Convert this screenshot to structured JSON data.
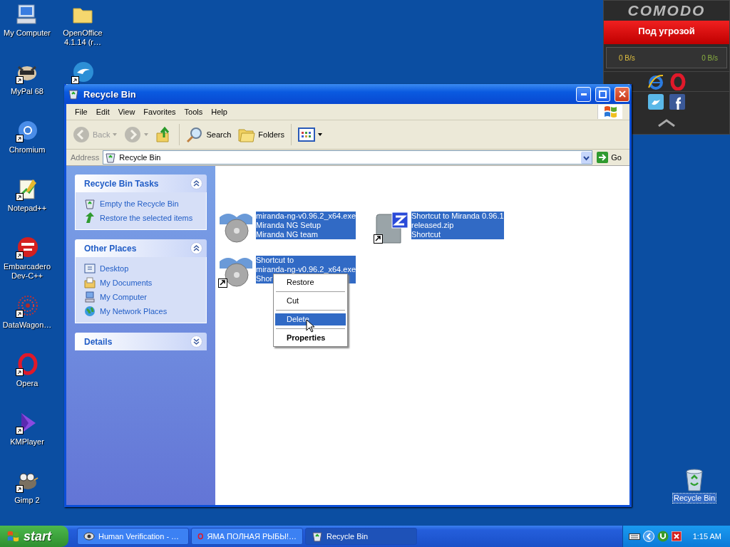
{
  "desktop": {
    "columns": [
      [
        {
          "label": "My Computer",
          "kind": "computer",
          "shortcut": false
        },
        {
          "label": "MyPal 68",
          "kind": "raccoon",
          "shortcut": true
        },
        {
          "label": "Chromium",
          "kind": "chromium",
          "shortcut": true
        },
        {
          "label": "Notepad++",
          "kind": "notepad",
          "shortcut": true
        },
        {
          "label": "Embarcadero Dev-C++",
          "kind": "dev",
          "shortcut": true
        },
        {
          "label": "DataWagon…",
          "kind": "datawagon",
          "shortcut": true
        },
        {
          "label": "Opera",
          "kind": "opera",
          "shortcut": true
        },
        {
          "label": "KMPlayer",
          "kind": "kmplayer",
          "shortcut": true
        },
        {
          "label": "Gimp 2",
          "kind": "gimp",
          "shortcut": true
        }
      ],
      [
        {
          "label": "OpenOffice 4.1.14 (r…",
          "kind": "folder",
          "shortcut": false
        },
        {
          "kind": "openoffice",
          "shortcut": true
        }
      ]
    ],
    "recycle_bin": {
      "label": "Recycle Bin",
      "selected": true
    }
  },
  "window": {
    "title": "Recycle Bin",
    "menu": [
      "File",
      "Edit",
      "View",
      "Favorites",
      "Tools",
      "Help"
    ],
    "toolbar": [
      {
        "kind": "back",
        "label": "Back",
        "disabled": true
      },
      {
        "kind": "forward",
        "disabled": true
      },
      {
        "kind": "up",
        "disabled": false
      },
      {
        "kind": "search",
        "label": "Search",
        "disabled": false
      },
      {
        "kind": "folders",
        "label": "Folders",
        "disabled": false
      },
      {
        "kind": "views",
        "disabled": false
      }
    ],
    "address": {
      "label": "Address",
      "value": "Recycle Bin",
      "go": "Go"
    },
    "panels": [
      {
        "title": "Recycle Bin Tasks",
        "expanded": true,
        "items": [
          {
            "label": "Empty the Recycle Bin",
            "kind": "recycle"
          },
          {
            "label": "Restore the selected items",
            "kind": "restore"
          }
        ]
      },
      {
        "title": "Other Places",
        "expanded": true,
        "items": [
          {
            "label": "Desktop",
            "kind": "desktop"
          },
          {
            "label": "My Documents",
            "kind": "documents"
          },
          {
            "label": "My Computer",
            "kind": "computer"
          },
          {
            "label": "My Network Places",
            "kind": "network"
          }
        ]
      },
      {
        "title": "Details",
        "expanded": false
      }
    ],
    "files": [
      {
        "lines": [
          "miranda-ng-v0.96.2_x64.exe",
          "Miranda NG Setup",
          "Miranda NG team"
        ],
        "kind": "installer",
        "shortcut": false,
        "selected": true
      },
      {
        "lines": [
          "Shortcut to Miranda 0.96.1",
          "released.zip",
          "Shortcut"
        ],
        "kind": "zip",
        "shortcut": true,
        "selected": true
      },
      {
        "lines": [
          "Shortcut to",
          "miranda-ng-v0.96.2_x64.exe",
          "Shor"
        ],
        "kind": "installer",
        "shortcut": true,
        "selected": true
      }
    ],
    "context_menu": [
      {
        "label": "Restore",
        "selected": false,
        "default": false
      },
      {
        "label": "Cut",
        "selected": false,
        "default": false
      },
      {
        "label": "Delete",
        "selected": true,
        "default": false
      },
      {
        "label": "Properties",
        "selected": false,
        "default": true
      }
    ]
  },
  "comodo": {
    "title": "COMODO",
    "status": "Под угрозой",
    "download": "0 B/s",
    "upload": "0 B/s"
  },
  "taskbar": {
    "start": "start",
    "tasks": [
      {
        "label": "Human Verification - …",
        "kind": "eye",
        "selected": false
      },
      {
        "label": "ЯМА ПОЛНАЯ РЫБЫ!…",
        "kind": "opera",
        "selected": false
      },
      {
        "label": "Recycle Bin",
        "kind": "recycle",
        "selected": true
      }
    ],
    "clock": "1:15 AM"
  }
}
